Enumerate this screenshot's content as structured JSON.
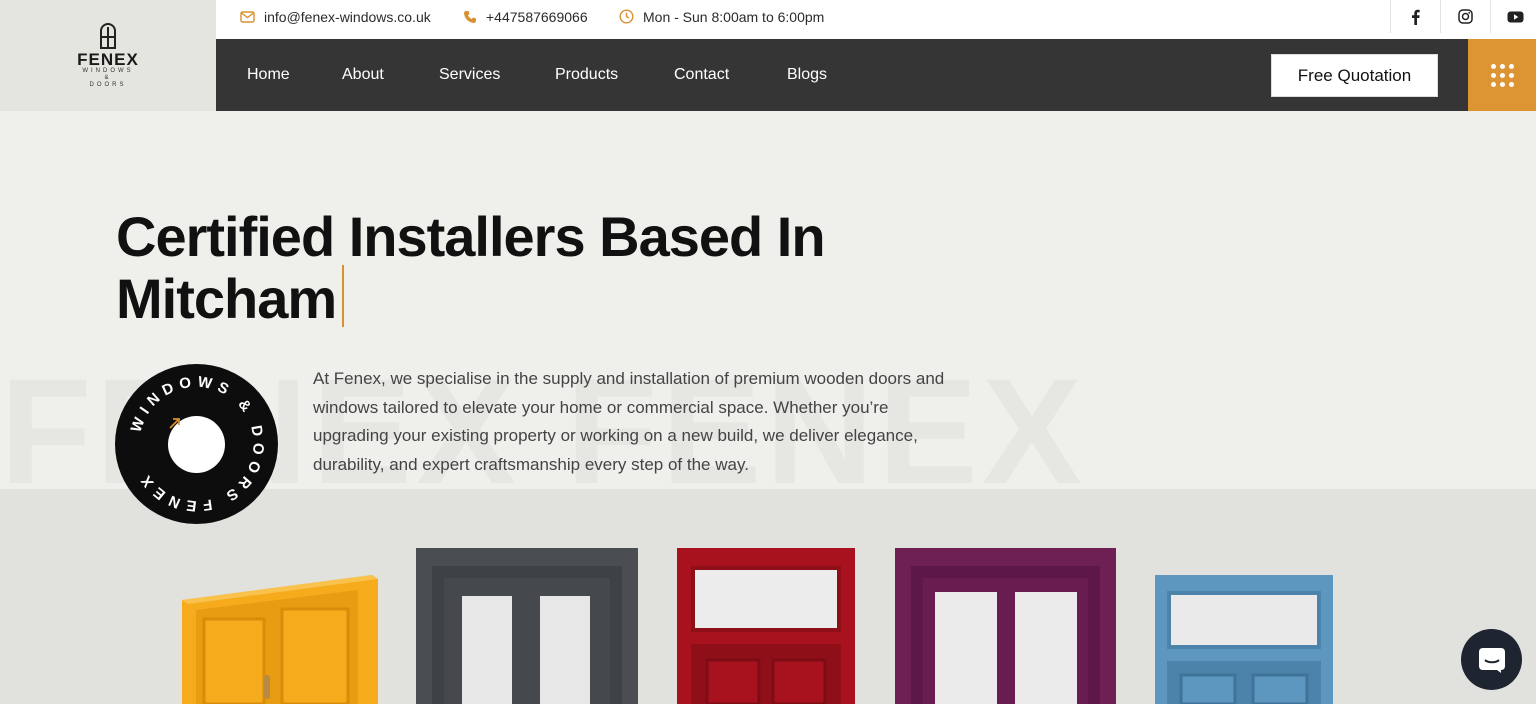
{
  "brand": {
    "name": "FENEX",
    "sub1": "WINDOWS",
    "sub2": "&",
    "sub3": "DOORS"
  },
  "topbar": {
    "email": "info@fenex-windows.co.uk",
    "phone": "+447587669066",
    "hours": "Mon - Sun 8:00am to 6:00pm",
    "social": [
      "facebook-icon",
      "instagram-icon",
      "youtube-icon"
    ]
  },
  "nav": {
    "items": [
      {
        "label": "Home"
      },
      {
        "label": "About"
      },
      {
        "label": "Services"
      },
      {
        "label": "Products"
      },
      {
        "label": "Contact"
      },
      {
        "label": "Blogs"
      }
    ],
    "cta": "Free Quotation"
  },
  "hero": {
    "title_line1": "Certified Installers Based In",
    "title_line2": "Mitcham",
    "description": "At Fenex, we specialise in the supply and installation of premium wooden doors and windows tailored to elevate your home or commercial space. Whether you’re upgrading your existing property or working on a new build, we deliver elegance, durability, and expert craftsmanship every step of the way.",
    "watermark": "FENEX FENEX",
    "badge_text": "WINDOWS & DOORS FENEX"
  },
  "colors": {
    "accent": "#dc9532",
    "nav_bg": "#353535",
    "door_yellow": "#f5ab1c",
    "door_grey": "#4a4d52",
    "door_red": "#a8121e",
    "door_purple": "#6e1f54",
    "door_blue": "#5d97c0"
  }
}
